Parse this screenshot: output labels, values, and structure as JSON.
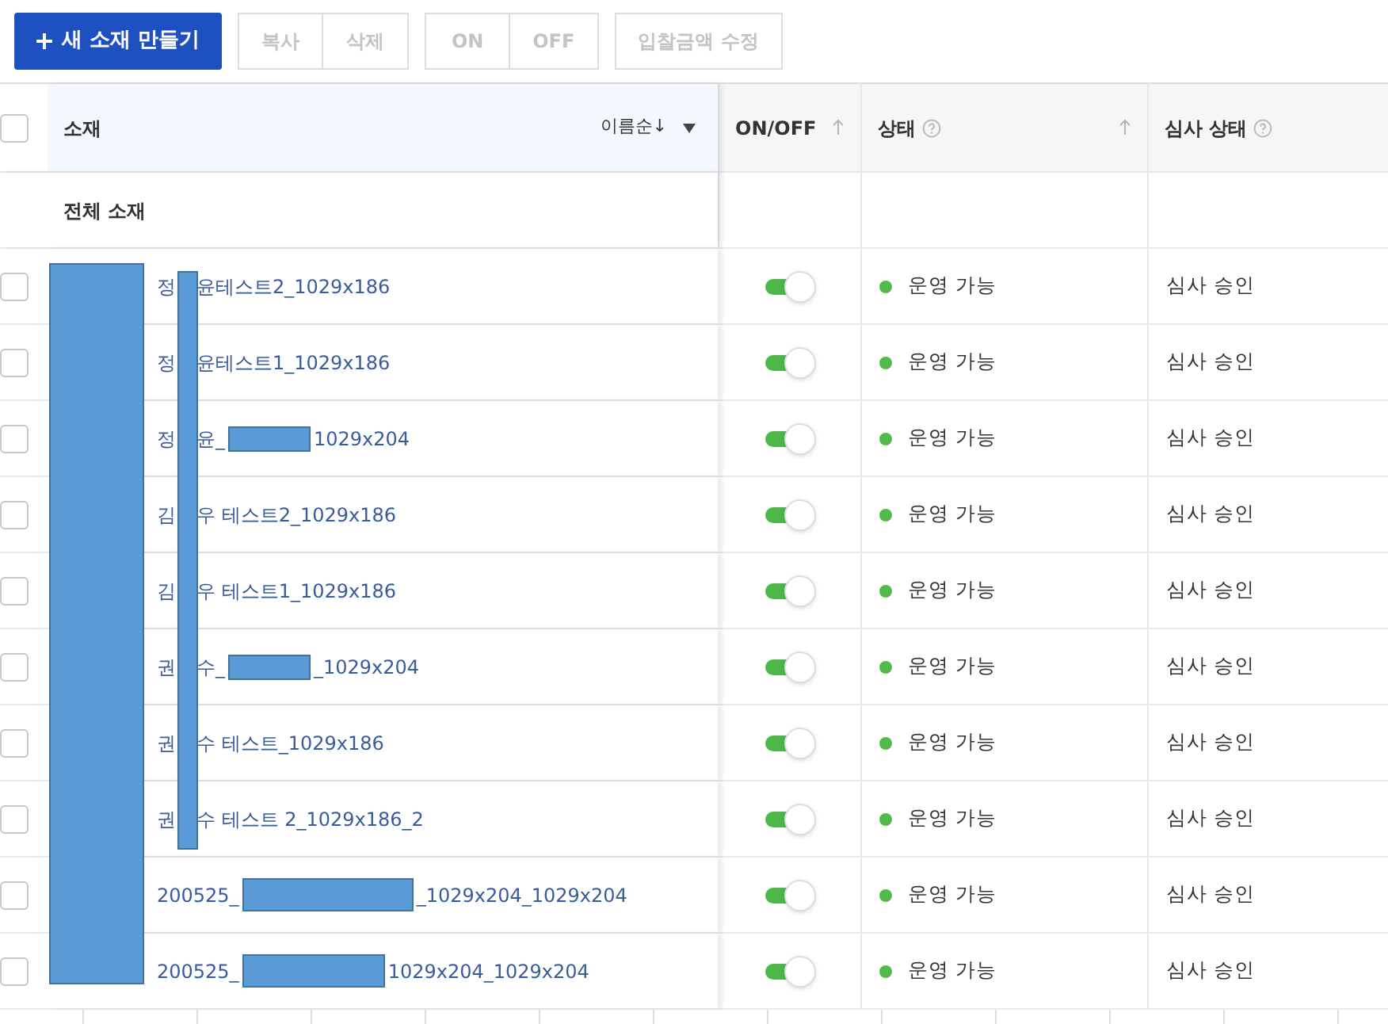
{
  "toolbar": {
    "create_button": {
      "label": "새 소재 만들기"
    },
    "groups": [
      [
        "복사",
        "삭제"
      ],
      [
        "ON",
        "OFF"
      ],
      [
        "입찰금액 수정"
      ]
    ]
  },
  "table": {
    "header_checkbox": {
      "checked": false
    },
    "columns": [
      {
        "label": "소재",
        "sort_label": "이름순↓",
        "kind": "name"
      },
      {
        "label": "ON/OFF",
        "kind": "sortable"
      },
      {
        "label": "상태",
        "kind": "help_sortable"
      },
      {
        "label": "심사 상태",
        "kind": "help"
      }
    ],
    "group_row": {
      "label": "전체 소재"
    },
    "rows": [
      {
        "checked": false,
        "name": [
          {
            "kind": "text",
            "text": "정"
          },
          {
            "kind": "gap"
          },
          {
            "kind": "text",
            "text": "윤테스트2_1029x186"
          }
        ],
        "on": true,
        "status": "운영 가능",
        "color": "#52b94c",
        "review": "심사 승인"
      },
      {
        "checked": false,
        "name": [
          {
            "kind": "text",
            "text": "정"
          },
          {
            "kind": "gap"
          },
          {
            "kind": "text",
            "text": "윤테스트1_1029x186"
          }
        ],
        "on": true,
        "status": "운영 가능",
        "color": "#52b94c",
        "review": "심사 승인"
      },
      {
        "checked": false,
        "name": [
          {
            "kind": "text",
            "text": "정"
          },
          {
            "kind": "gap"
          },
          {
            "kind": "text",
            "text": "윤_"
          },
          {
            "kind": "mask"
          },
          {
            "kind": "text",
            "text": "1029x204"
          }
        ],
        "on": true,
        "status": "운영 가능",
        "color": "#52b94c",
        "review": "심사 승인"
      },
      {
        "checked": false,
        "name": [
          {
            "kind": "text",
            "text": "김"
          },
          {
            "kind": "gap"
          },
          {
            "kind": "text",
            "text": "우 테스트2_1029x186"
          }
        ],
        "on": true,
        "status": "운영 가능",
        "color": "#52b94c",
        "review": "심사 승인"
      },
      {
        "checked": false,
        "name": [
          {
            "kind": "text",
            "text": "김"
          },
          {
            "kind": "gap"
          },
          {
            "kind": "text",
            "text": "우 테스트1_1029x186"
          }
        ],
        "on": true,
        "status": "운영 가능",
        "color": "#52b94c",
        "review": "심사 승인"
      },
      {
        "checked": false,
        "name": [
          {
            "kind": "text",
            "text": "권"
          },
          {
            "kind": "gap"
          },
          {
            "kind": "text",
            "text": "수_"
          },
          {
            "kind": "mask"
          },
          {
            "kind": "text",
            "text": "_1029x204"
          }
        ],
        "on": true,
        "status": "운영 가능",
        "color": "#52b94c",
        "review": "심사 승인"
      },
      {
        "checked": false,
        "name": [
          {
            "kind": "text",
            "text": "권"
          },
          {
            "kind": "gap"
          },
          {
            "kind": "text",
            "text": "수 테스트_1029x186"
          }
        ],
        "on": true,
        "status": "운영 가능",
        "color": "#52b94c",
        "review": "심사 승인"
      },
      {
        "checked": false,
        "name": [
          {
            "kind": "text",
            "text": "권"
          },
          {
            "kind": "gap"
          },
          {
            "kind": "text",
            "text": "수 테스트 2_1029x186_2"
          }
        ],
        "on": true,
        "status": "운영 가능",
        "color": "#52b94c",
        "review": "심사 승인"
      },
      {
        "checked": false,
        "name": [
          {
            "kind": "text",
            "text": "200525_"
          },
          {
            "kind": "wide_mask"
          },
          {
            "kind": "text",
            "text": "_1029x204_1029x204"
          }
        ],
        "on": true,
        "status": "운영 가능",
        "color": "#52b94c",
        "review": "심사 승인"
      },
      {
        "checked": false,
        "name": [
          {
            "kind": "text",
            "text": "200525_"
          },
          {
            "kind": "mid_mask"
          },
          {
            "kind": "text",
            "text": "1029x204_1029x204"
          }
        ],
        "on": true,
        "status": "운영 가능",
        "color": "#52b94c",
        "review": "심사 승인"
      }
    ]
  }
}
